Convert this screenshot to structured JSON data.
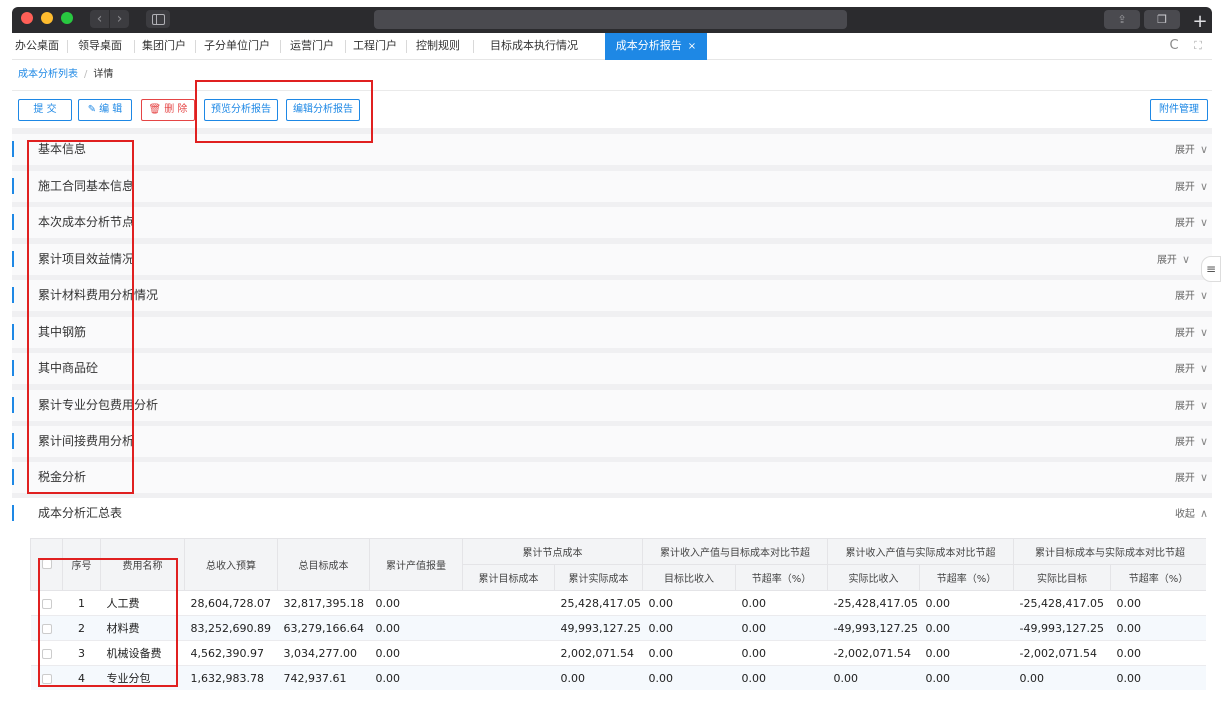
{
  "browser": {
    "back_glyph": "‹",
    "forward_glyph": "›",
    "share_icon": "share-icon",
    "tabs_icon": "tabs-icon",
    "plus_glyph": "+"
  },
  "nav": {
    "items": [
      {
        "label": "办公桌面"
      },
      {
        "label": "领导桌面"
      },
      {
        "label": "集团门户"
      },
      {
        "label": "子分单位门户"
      },
      {
        "label": "运营门户"
      },
      {
        "label": "工程门户"
      },
      {
        "label": "控制规则"
      },
      {
        "label": "目标成本执行情况"
      },
      {
        "label": "成本分析报告",
        "close": "×"
      }
    ],
    "reload_glyph": "C",
    "fullscreen_glyph": "⛶"
  },
  "breadcrumb": {
    "parent": "成本分析列表",
    "separator": "/",
    "current": "详情"
  },
  "toolbar": {
    "submit_label": "提 交",
    "edit_icon": "✎",
    "edit_label": "编 辑",
    "delete_icon": "🗑",
    "delete_label": "删 除",
    "preview_label": "预览分析报告",
    "edit_report_label": "编辑分析报告",
    "attachments_label": "附件管理"
  },
  "sections": [
    {
      "title": "基本信息",
      "toggle": "展开",
      "chevron": "∨"
    },
    {
      "title": "施工合同基本信息",
      "toggle": "展开",
      "chevron": "∨"
    },
    {
      "title": "本次成本分析节点",
      "toggle": "展开",
      "chevron": "∨"
    },
    {
      "title": "累计项目效益情况",
      "toggle": "展开",
      "chevron": "∨"
    },
    {
      "title": "累计材料费用分析情况",
      "toggle": "展开",
      "chevron": "∨"
    },
    {
      "title": "其中钢筋",
      "toggle": "展开",
      "chevron": "∨"
    },
    {
      "title": "其中商品砼",
      "toggle": "展开",
      "chevron": "∨"
    },
    {
      "title": "累计专业分包费用分析",
      "toggle": "展开",
      "chevron": "∨"
    },
    {
      "title": "累计间接费用分析",
      "toggle": "展开",
      "chevron": "∨"
    },
    {
      "title": "税金分析",
      "toggle": "展开",
      "chevron": "∨"
    },
    {
      "title": "成本分析汇总表",
      "toggle": "收起",
      "chevron": "∧"
    }
  ],
  "float_glyph": "≡",
  "table": {
    "headers": {
      "seq": "序号",
      "name": "费用名称",
      "total_budget": "总收入预算",
      "total_target": "总目标成本",
      "cum_output": "累计产值报量",
      "group1": "累计节点成本",
      "group1_a": "累计目标成本",
      "group1_b": "累计实际成本",
      "group2": "累计收入产值与目标成本对比节超",
      "group2_a": "目标比收入",
      "group2_b": "节超率（%）",
      "group3": "累计收入产值与实际成本对比节超",
      "group3_a": "实际比收入",
      "group3_b": "节超率（%）",
      "group4": "累计目标成本与实际成本对比节超",
      "group4_a": "实际比目标",
      "group4_b": "节超率（%）"
    },
    "rows": [
      {
        "seq": "1",
        "name": "人工费",
        "budget": "28,604,728.07",
        "target": "32,817,395.18",
        "output": "0.00",
        "cum_target": "",
        "cum_actual": "25,428,417.05",
        "g2a": "0.00",
        "g2b": "0.00",
        "g3a": "-25,428,417.05",
        "g3b": "0.00",
        "g4a": "-25,428,417.05",
        "g4b": "0.00"
      },
      {
        "seq": "2",
        "name": "材料费",
        "budget": "83,252,690.89",
        "target": "63,279,166.64",
        "output": "0.00",
        "cum_target": "",
        "cum_actual": "49,993,127.25",
        "g2a": "0.00",
        "g2b": "0.00",
        "g3a": "-49,993,127.25",
        "g3b": "0.00",
        "g4a": "-49,993,127.25",
        "g4b": "0.00"
      },
      {
        "seq": "3",
        "name": "机械设备费",
        "budget": "4,562,390.97",
        "target": "3,034,277.00",
        "output": "0.00",
        "cum_target": "",
        "cum_actual": "2,002,071.54",
        "g2a": "0.00",
        "g2b": "0.00",
        "g3a": "-2,002,071.54",
        "g3b": "0.00",
        "g4a": "-2,002,071.54",
        "g4b": "0.00"
      },
      {
        "seq": "4",
        "name": "专业分包",
        "budget": "1,632,983.78",
        "target": "742,937.61",
        "output": "0.00",
        "cum_target": "",
        "cum_actual": "0.00",
        "g2a": "0.00",
        "g2b": "0.00",
        "g3a": "0.00",
        "g3b": "0.00",
        "g4a": "0.00",
        "g4b": "0.00"
      }
    ]
  },
  "colors": {
    "accent": "#1e88e5",
    "danger": "#e54545",
    "annotation": "#e02020",
    "titlebar": "#2b2b2e"
  }
}
